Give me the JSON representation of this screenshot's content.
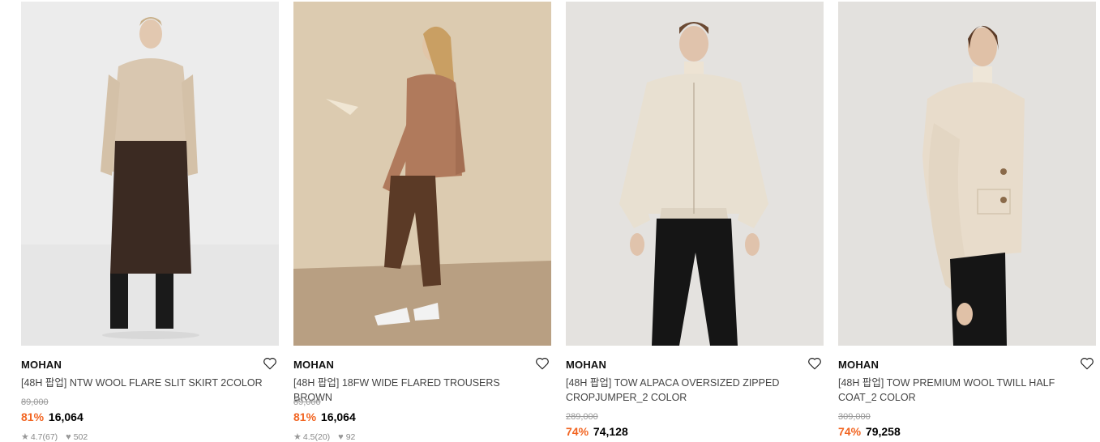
{
  "products": [
    {
      "brand": "MOHAN",
      "title": "[48H 팝업] NTW WOOL FLARE SLIT SKIRT 2COLOR",
      "original_price": "89,000",
      "discount": "81%",
      "sale_price": "16,064",
      "rating": "4.7",
      "reviews": "(67)",
      "likes": "502",
      "image_icon": "model-photo"
    },
    {
      "brand": "MOHAN",
      "title": "[48H 팝업] 18FW WIDE FLARED TROUSERS BROWN",
      "original_price": "89,000",
      "discount": "81%",
      "sale_price": "16,064",
      "rating": "4.5",
      "reviews": "(20)",
      "likes": "92",
      "image_icon": "model-photo"
    },
    {
      "brand": "MOHAN",
      "title": "[48H 팝업] TOW ALPACA OVERSIZED ZIPPED CROPJUMPER_2 COLOR",
      "original_price": "289,000",
      "discount": "74%",
      "sale_price": "74,128",
      "image_icon": "model-photo"
    },
    {
      "brand": "MOHAN",
      "title": "[48H 팝업] TOW PREMIUM WOOL TWILL HALF COAT_2 COLOR",
      "original_price": "309,000",
      "discount": "74%",
      "sale_price": "79,258",
      "image_icon": "model-photo"
    }
  ],
  "colors": {
    "discount": "#f26522",
    "original_price": "#999999",
    "title": "#444444"
  }
}
